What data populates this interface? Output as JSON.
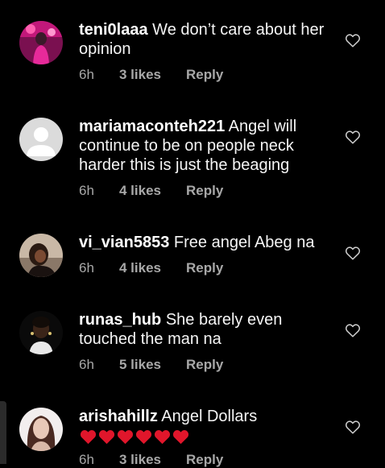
{
  "comments": [
    {
      "username": "teni0laaa",
      "text": "We don’t care about her opinion",
      "time": "6h",
      "likes": "3 likes",
      "reply": "Reply"
    },
    {
      "username": "mariamaconteh221",
      "text": "Angel will continue to be on people neck harder this is just the beaging",
      "time": "6h",
      "likes": "4 likes",
      "reply": "Reply"
    },
    {
      "username": "vi_vian5853",
      "text": "Free angel Abeg na",
      "time": "6h",
      "likes": "4 likes",
      "reply": "Reply"
    },
    {
      "username": "runas_hub",
      "text": "She barely even touched the man na",
      "time": "6h",
      "likes": "5 likes",
      "reply": "Reply"
    },
    {
      "username": "arishahillz",
      "text": "Angel Dollars",
      "emoji": "red-heart x6",
      "time": "6h",
      "likes": "3 likes",
      "reply": "Reply"
    }
  ],
  "icons": {
    "like": "heart-outline-icon",
    "default_avatar": "default-avatar-icon"
  },
  "colors": {
    "background": "#000000",
    "text": "#ffffff",
    "meta": "#a8a8a8",
    "heart_emoji": "#e0162b"
  }
}
